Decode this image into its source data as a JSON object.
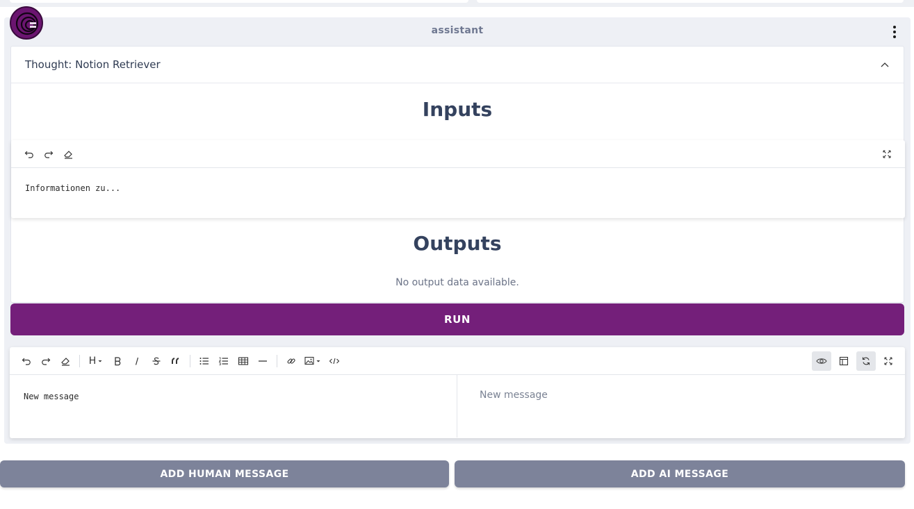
{
  "message": {
    "role": "assistant",
    "thought_title": "Thought: Notion Retriever",
    "inputs_heading": "Inputs",
    "input_text": "Informationen zu...",
    "outputs_heading": "Outputs",
    "no_output_text": "No output data available.",
    "run_label": "RUN"
  },
  "composer": {
    "source_placeholder": "New message",
    "preview_placeholder": "New message",
    "heading_label": "H"
  },
  "actions": {
    "add_human": "ADD HUMAN MESSAGE",
    "add_ai": "ADD AI MESSAGE"
  },
  "colors": {
    "accent": "#741f7a",
    "secondary_button": "#7d839a",
    "card_bg": "#eef0f5"
  }
}
